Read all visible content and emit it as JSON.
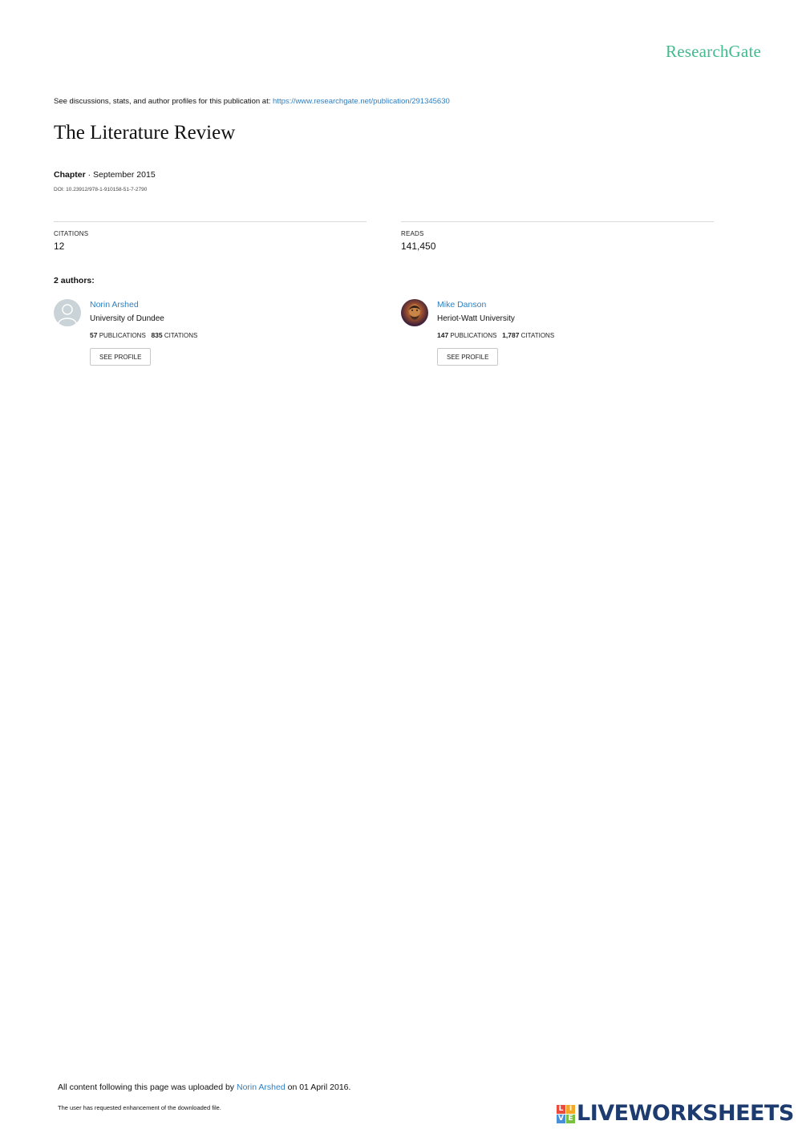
{
  "header": {
    "brand": "ResearchGate"
  },
  "intro": {
    "text": "See discussions, stats, and author profiles for this publication at: ",
    "url": "https://www.researchgate.net/publication/291345630"
  },
  "publication": {
    "title": "The Literature Review",
    "type": "Chapter",
    "date": " · September 2015",
    "doi": "DOI: 10.23912/978-1-910158-51-7-2790"
  },
  "stats": {
    "citations_label": "CITATIONS",
    "citations_value": "12",
    "reads_label": "READS",
    "reads_value": "141,450"
  },
  "authors_heading": "2 authors:",
  "authors": [
    {
      "name": "Norin Arshed",
      "institution": "University of Dundee",
      "publications": "57",
      "publications_label": " PUBLICATIONS",
      "citations": "835",
      "citations_label": " CITATIONS",
      "button": "SEE PROFILE"
    },
    {
      "name": "Mike Danson",
      "institution": "Heriot-Watt University",
      "publications": "147",
      "publications_label": " PUBLICATIONS",
      "citations": "1,787",
      "citations_label": " CITATIONS",
      "button": "SEE PROFILE"
    }
  ],
  "footer": {
    "uploaded_prefix": "All content following this page was uploaded by ",
    "uploader": "Norin Arshed",
    "uploaded_suffix": " on 01 April 2016.",
    "enhancement": "The user has requested enhancement of the downloaded file."
  },
  "watermark": {
    "letters": [
      "L",
      "I",
      "V",
      "E"
    ],
    "colors": [
      "#e94b3c",
      "#f5a623",
      "#4a90d9",
      "#7ac143"
    ],
    "text": "LIVEWORKSHEETS"
  }
}
